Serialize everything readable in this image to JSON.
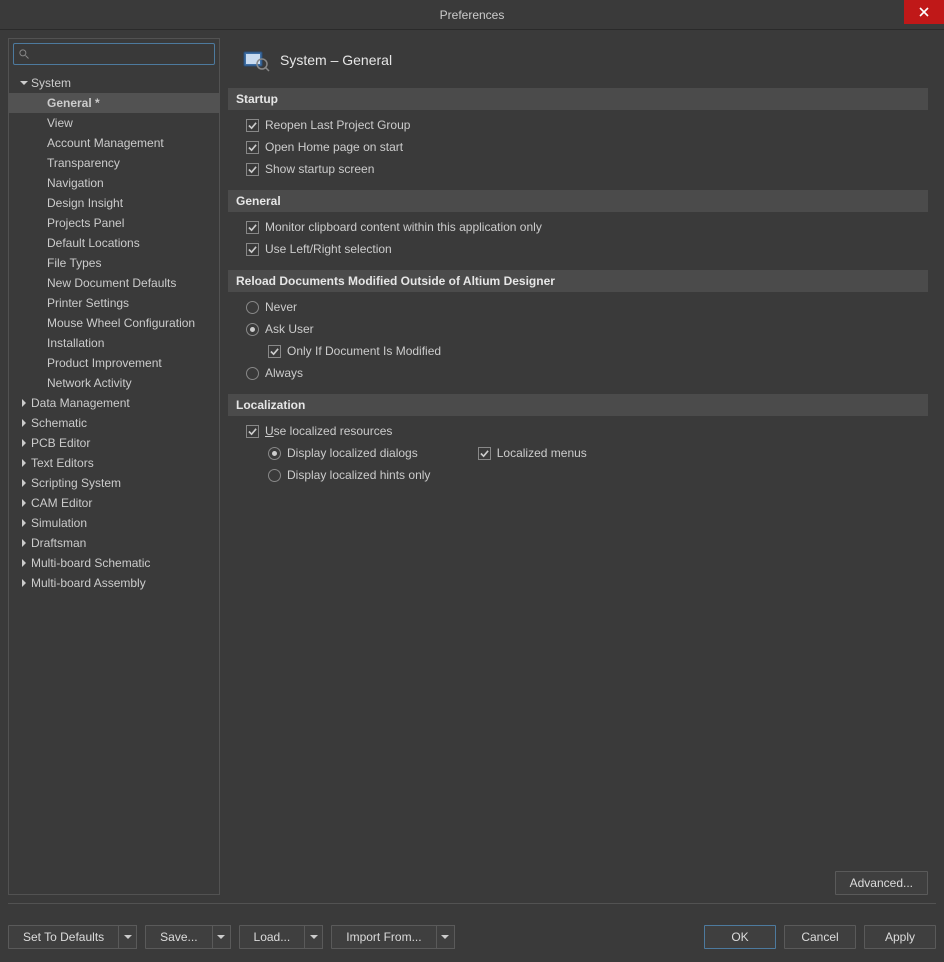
{
  "window": {
    "title": "Preferences"
  },
  "sidebar": {
    "search_placeholder": "",
    "nodes": [
      {
        "label": "System",
        "expanded": true,
        "children": [
          {
            "label": "General *",
            "selected": true
          },
          {
            "label": "View"
          },
          {
            "label": "Account Management"
          },
          {
            "label": "Transparency"
          },
          {
            "label": "Navigation"
          },
          {
            "label": "Design Insight"
          },
          {
            "label": "Projects Panel"
          },
          {
            "label": "Default Locations"
          },
          {
            "label": "File Types"
          },
          {
            "label": "New Document Defaults"
          },
          {
            "label": "Printer Settings"
          },
          {
            "label": "Mouse Wheel Configuration"
          },
          {
            "label": "Installation"
          },
          {
            "label": "Product Improvement"
          },
          {
            "label": "Network Activity"
          }
        ]
      },
      {
        "label": "Data Management",
        "expanded": false
      },
      {
        "label": "Schematic",
        "expanded": false
      },
      {
        "label": "PCB Editor",
        "expanded": false
      },
      {
        "label": "Text Editors",
        "expanded": false
      },
      {
        "label": "Scripting System",
        "expanded": false
      },
      {
        "label": "CAM Editor",
        "expanded": false
      },
      {
        "label": "Simulation",
        "expanded": false
      },
      {
        "label": "Draftsman",
        "expanded": false
      },
      {
        "label": "Multi-board Schematic",
        "expanded": false
      },
      {
        "label": "Multi-board Assembly",
        "expanded": false
      }
    ]
  },
  "content": {
    "title": "System – General",
    "sections": {
      "startup": {
        "title": "Startup",
        "reopen": {
          "label": "Reopen Last Project Group",
          "checked": true
        },
        "openhome": {
          "label": "Open Home page on start",
          "checked": true
        },
        "showstartup": {
          "label": "Show startup screen",
          "checked": true
        }
      },
      "general": {
        "title": "General",
        "monitor": {
          "label": "Monitor clipboard content within this application only",
          "checked": true
        },
        "leftright": {
          "label": "Use Left/Right selection",
          "checked": true
        }
      },
      "reload": {
        "title": "Reload Documents Modified Outside of Altium Designer",
        "never": {
          "label": "Never"
        },
        "askuser": {
          "label": "Ask User"
        },
        "onlyif": {
          "label": "Only If Document Is Modified",
          "checked": true
        },
        "always": {
          "label": "Always"
        }
      },
      "localization": {
        "title": "Localization",
        "uselocal": {
          "label": "Use localized resources",
          "checked": true
        },
        "dialogs": {
          "label": "Display localized dialogs"
        },
        "menus": {
          "label": "Localized menus",
          "checked": true
        },
        "hints": {
          "label": "Display localized hints only"
        }
      }
    },
    "advanced": "Advanced..."
  },
  "footer": {
    "defaults": "Set To Defaults",
    "save": "Save...",
    "load": "Load...",
    "import": "Import From...",
    "ok": "OK",
    "cancel": "Cancel",
    "apply": "Apply"
  }
}
